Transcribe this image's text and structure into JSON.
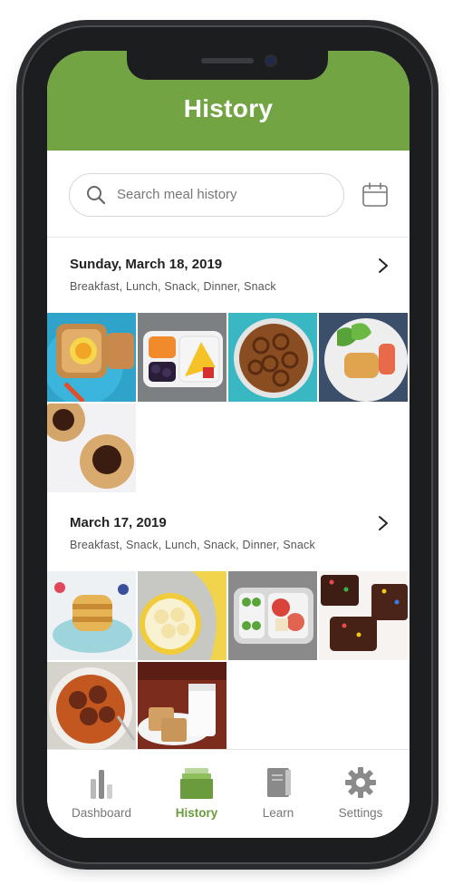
{
  "header": {
    "title": "History"
  },
  "search": {
    "placeholder": "Search meal history"
  },
  "icons": {
    "search": "search-icon",
    "calendar": "calendar-icon",
    "chevron": "chevron-right-icon"
  },
  "days": [
    {
      "date": "Sunday, March 18, 2019",
      "meals": "Breakfast, Lunch, Snack, Dinner, Snack",
      "photos": [
        "egg-toast-photo",
        "lunch-box-photo",
        "pretzels-photo",
        "salmon-salad-photo",
        "chocolate-cookies-photo"
      ]
    },
    {
      "date": "March 17, 2019",
      "meals": "Breakfast, Snack, Lunch, Snack, Dinner, Snack",
      "photos": [
        "pancakes-photo",
        "banana-photo",
        "bento-box-photo",
        "brownies-photo",
        "spaghetti-meatballs-photo",
        "milk-crackers-photo"
      ]
    }
  ],
  "tabs": [
    {
      "label": "Dashboard",
      "icon": "bar-chart-icon",
      "active": false
    },
    {
      "label": "History",
      "icon": "stack-icon",
      "active": true
    },
    {
      "label": "Learn",
      "icon": "book-icon",
      "active": false
    },
    {
      "label": "Settings",
      "icon": "gear-icon",
      "active": false
    }
  ],
  "colors": {
    "brand_green": "#73a444",
    "active_tab": "#6a9b3c",
    "inactive_tab": "#8a8a8a"
  }
}
